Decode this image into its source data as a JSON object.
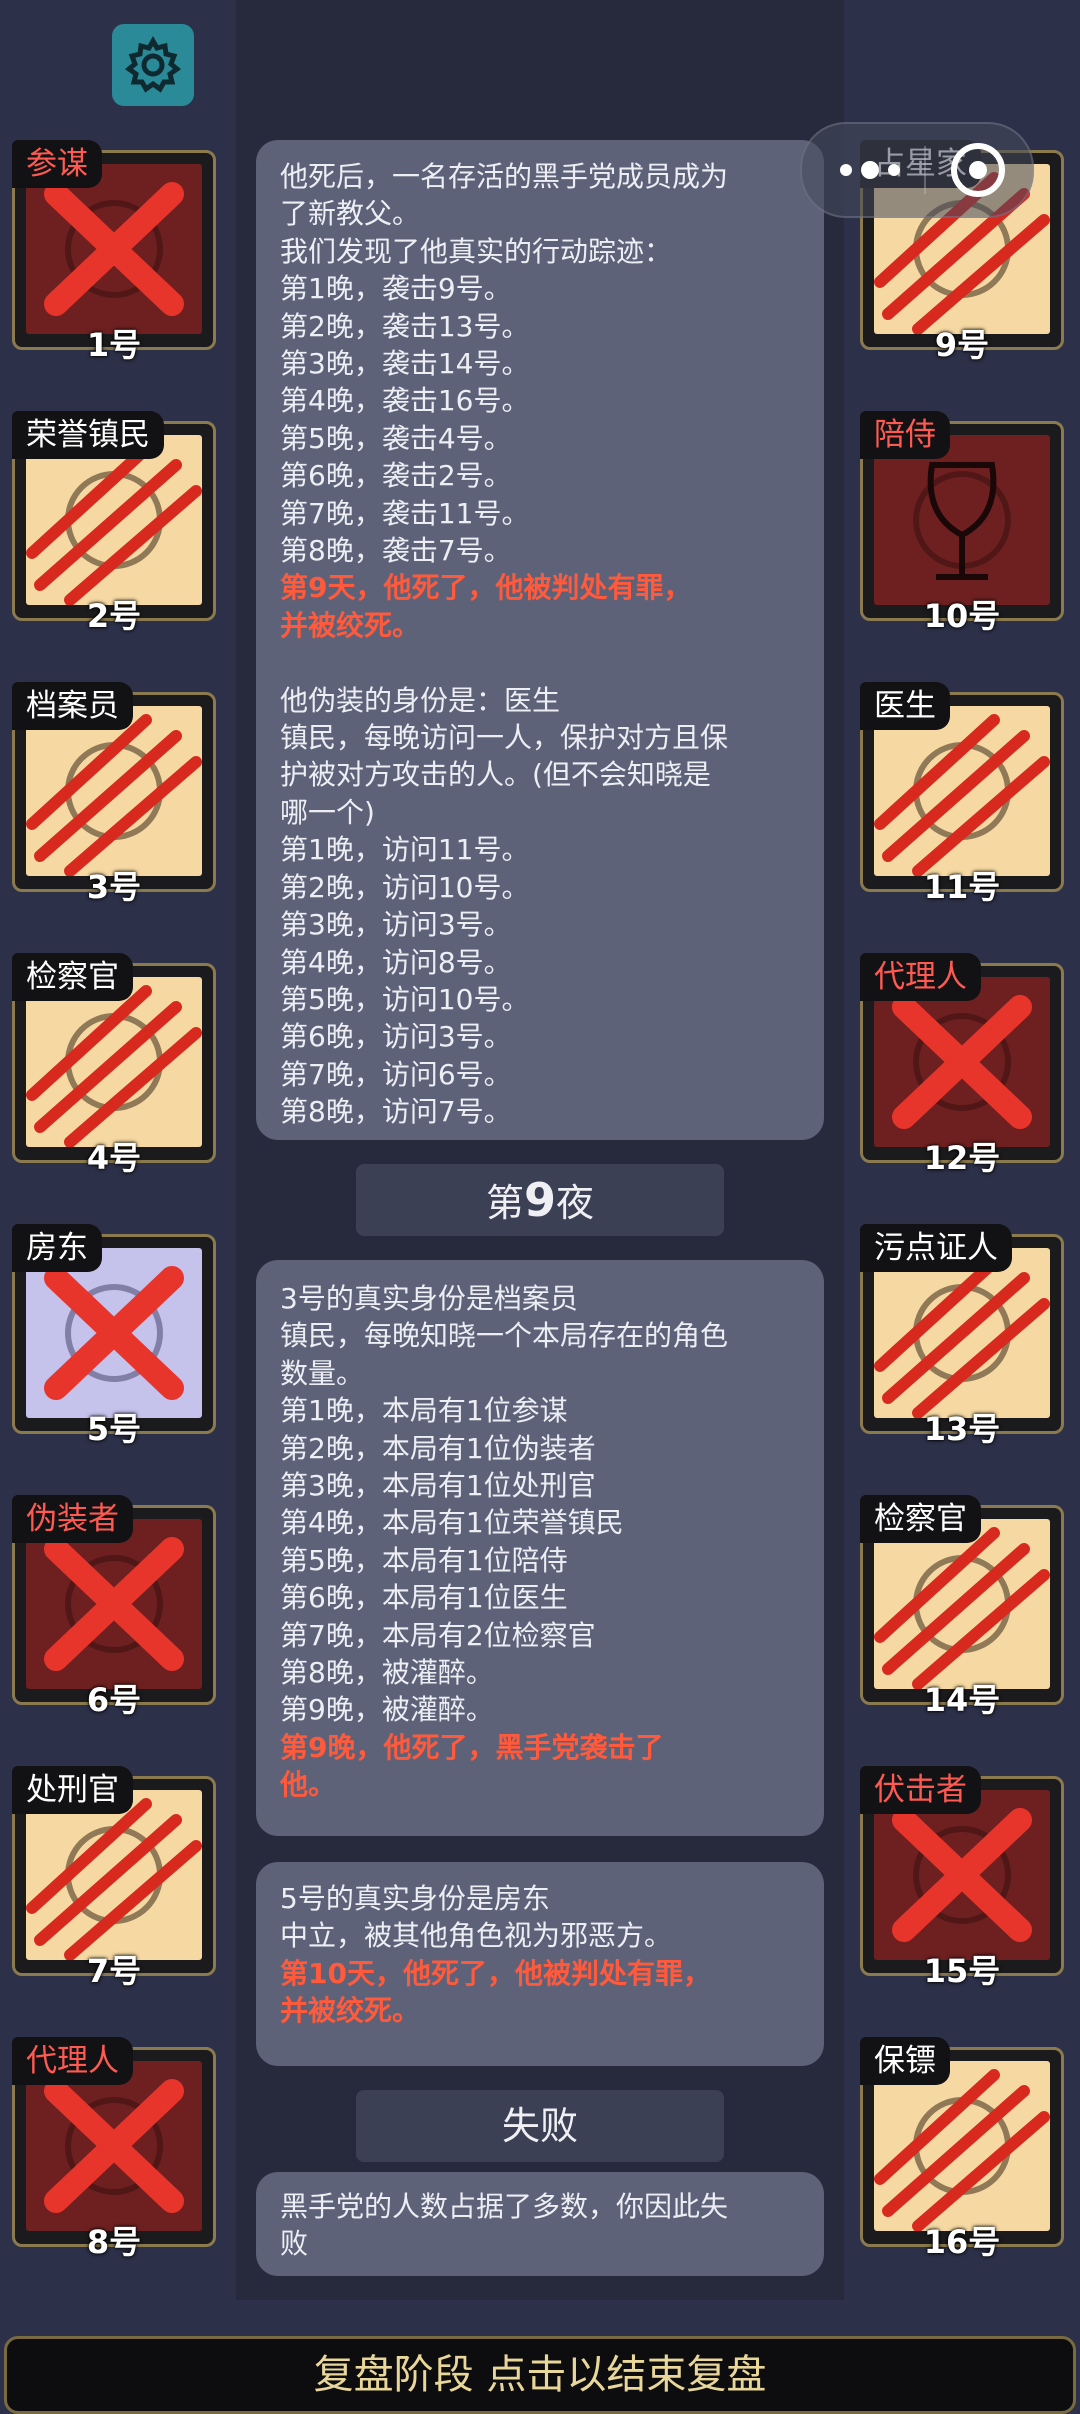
{
  "capsule": {
    "overlapped_text": "占星家"
  },
  "players": [
    {
      "role": "参谋",
      "number": "1号",
      "role_color": "red",
      "face": "dark",
      "mark": "x"
    },
    {
      "role": "荣誉镇民",
      "number": "2号",
      "role_color": "white",
      "face": "light",
      "mark": "claw"
    },
    {
      "role": "档案员",
      "number": "3号",
      "role_color": "white",
      "face": "light",
      "mark": "claw"
    },
    {
      "role": "检察官",
      "number": "4号",
      "role_color": "white",
      "face": "light",
      "mark": "claw"
    },
    {
      "role": "房东",
      "number": "5号",
      "role_color": "white",
      "face": "purple",
      "mark": "x"
    },
    {
      "role": "伪装者",
      "number": "6号",
      "role_color": "red",
      "face": "dark",
      "mark": "x"
    },
    {
      "role": "处刑官",
      "number": "7号",
      "role_color": "white",
      "face": "light",
      "mark": "claw"
    },
    {
      "role": "代理人",
      "number": "8号",
      "role_color": "red",
      "face": "dark",
      "mark": "x"
    },
    {
      "role": "占星家",
      "number": "9号",
      "role_color": "white",
      "face": "light",
      "mark": "claw"
    },
    {
      "role": "陪侍",
      "number": "10号",
      "role_color": "red",
      "face": "dark",
      "mark": "none"
    },
    {
      "role": "医生",
      "number": "11号",
      "role_color": "white",
      "face": "light",
      "mark": "claw"
    },
    {
      "role": "代理人",
      "number": "12号",
      "role_color": "red",
      "face": "dark",
      "mark": "x"
    },
    {
      "role": "污点证人",
      "number": "13号",
      "role_color": "white",
      "face": "light",
      "mark": "claw"
    },
    {
      "role": "检察官",
      "number": "14号",
      "role_color": "white",
      "face": "light",
      "mark": "claw"
    },
    {
      "role": "伏击者",
      "number": "15号",
      "role_color": "red",
      "face": "dark",
      "mark": "x"
    },
    {
      "role": "保镖",
      "number": "16号",
      "role_color": "white",
      "face": "light",
      "mark": "claw"
    }
  ],
  "messages": [
    {
      "lines": [
        {
          "text": "他死后，一名存活的黑手党成员成为",
          "red": false
        },
        {
          "text": "了新教父。",
          "red": false
        },
        {
          "text": "我们发现了他真实的行动踪迹：",
          "red": false
        },
        {
          "text": "第1晚，袭击9号。",
          "red": false
        },
        {
          "text": "第2晚，袭击13号。",
          "red": false
        },
        {
          "text": "第3晚，袭击14号。",
          "red": false
        },
        {
          "text": "第4晚，袭击16号。",
          "red": false
        },
        {
          "text": "第5晚，袭击4号。",
          "red": false
        },
        {
          "text": "第6晚，袭击2号。",
          "red": false
        },
        {
          "text": "第7晚，袭击11号。",
          "red": false
        },
        {
          "text": "第8晚，袭击7号。",
          "red": false
        },
        {
          "text": "第9天，他死了，他被判处有罪，",
          "red": true
        },
        {
          "text": "并被绞死。",
          "red": true
        },
        {
          "text": "",
          "red": false
        },
        {
          "text": "他伪装的身份是：医生",
          "red": false
        },
        {
          "text": "镇民，每晚访问一人，保护对方且保",
          "red": false
        },
        {
          "text": "护被对方攻击的人。(但不会知晓是",
          "red": false
        },
        {
          "text": "哪一个)",
          "red": false
        },
        {
          "text": "第1晚，访问11号。",
          "red": false
        },
        {
          "text": "第2晚，访问10号。",
          "red": false
        },
        {
          "text": "第3晚，访问3号。",
          "red": false
        },
        {
          "text": "第4晚，访问8号。",
          "red": false
        },
        {
          "text": "第5晚，访问10号。",
          "red": false
        },
        {
          "text": "第6晚，访问3号。",
          "red": false
        },
        {
          "text": "第7晚，访问6号。",
          "red": false
        },
        {
          "text": "第8晚，访问7号。",
          "red": false
        }
      ]
    },
    {
      "lines": [
        {
          "text": "3号的真实身份是档案员",
          "red": false
        },
        {
          "text": "镇民，每晚知晓一个本局存在的角色",
          "red": false
        },
        {
          "text": "数量。",
          "red": false
        },
        {
          "text": "第1晚，本局有1位参谋",
          "red": false
        },
        {
          "text": "第2晚，本局有1位伪装者",
          "red": false
        },
        {
          "text": "第3晚，本局有1位处刑官",
          "red": false
        },
        {
          "text": "第4晚，本局有1位荣誉镇民",
          "red": false
        },
        {
          "text": "第5晚，本局有1位陪侍",
          "red": false
        },
        {
          "text": "第6晚，本局有1位医生",
          "red": false
        },
        {
          "text": "第7晚，本局有2位检察官",
          "red": false
        },
        {
          "text": "第8晚，被灌醉。",
          "red": false
        },
        {
          "text": "第9晚，被灌醉。",
          "red": false
        },
        {
          "text": "第9晚，他死了，黑手党袭击了",
          "red": true
        },
        {
          "text": "他。",
          "red": true
        }
      ]
    },
    {
      "lines": [
        {
          "text": "5号的真实身份是房东",
          "red": false
        },
        {
          "text": "中立，被其他角色视为邪恶方。",
          "red": false
        },
        {
          "text": "第10天，他死了，他被判处有罪，",
          "red": true
        },
        {
          "text": "并被绞死。",
          "red": true
        }
      ]
    },
    {
      "lines": [
        {
          "text": "黑手党的人数占据了多数，你因此失",
          "red": false
        },
        {
          "text": "败",
          "red": false
        }
      ]
    }
  ],
  "dividers": {
    "night9": {
      "prefix": "第",
      "number": "9",
      "suffix": "夜"
    },
    "result": "失败"
  },
  "bottom_bar": "复盘阶段 点击以结束复盘",
  "colors": {
    "background": "#2c3048",
    "red_text": "#ff5a3c",
    "card_light": "#f6d9a2",
    "card_dark": "#6e2020",
    "card_purple": "#c5c2ec",
    "teal_button": "#2a8a98",
    "gold_text": "#e9d79a"
  }
}
